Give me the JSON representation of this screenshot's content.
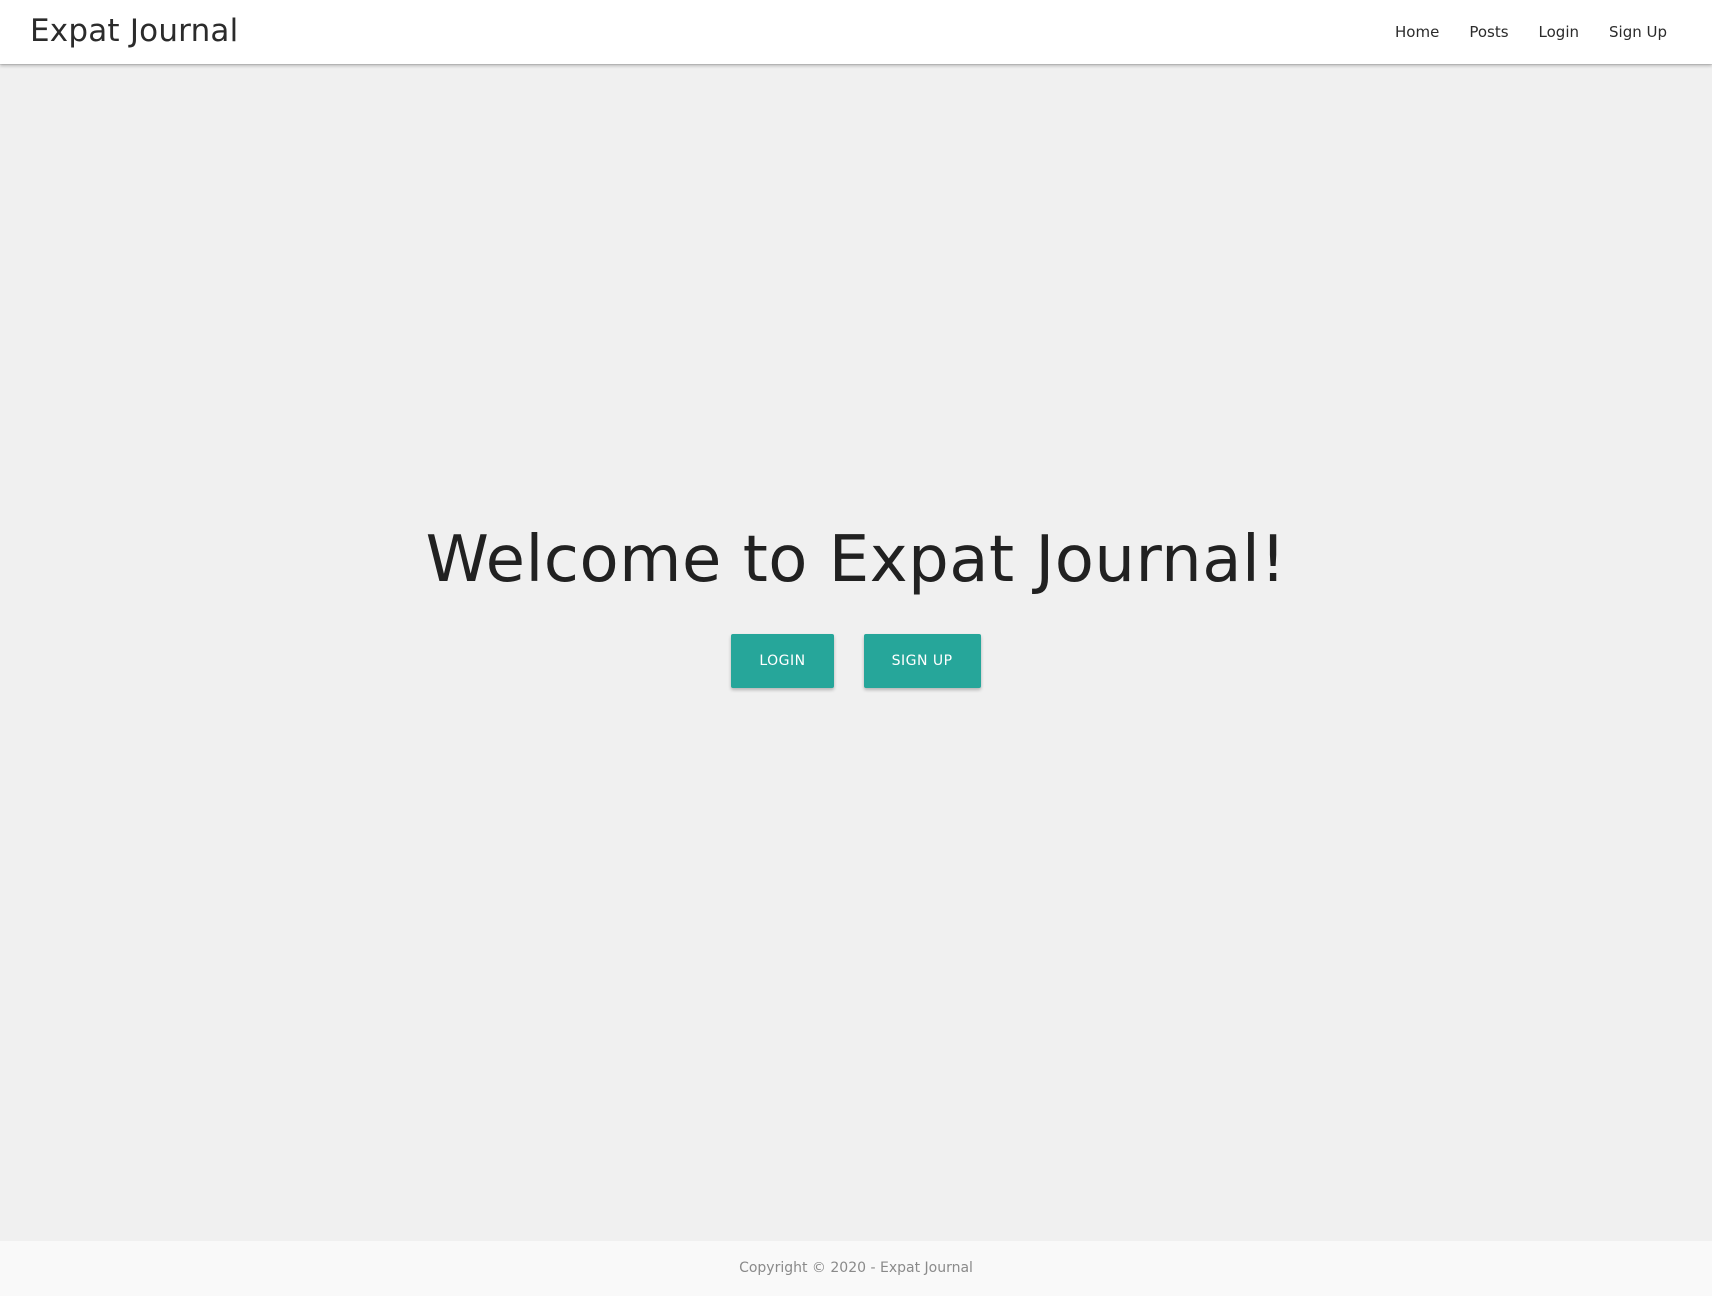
{
  "navbar": {
    "brand": "Expat Journal",
    "links": [
      {
        "label": "Home"
      },
      {
        "label": "Posts"
      },
      {
        "label": "Login"
      },
      {
        "label": "Sign Up"
      }
    ]
  },
  "hero": {
    "title": "Welcome to Expat Journal!",
    "login_label": "LOGIN",
    "signup_label": "SIGN UP"
  },
  "footer": {
    "text": "Copyright © 2020 - Expat Journal"
  },
  "colors": {
    "accent": "#26a69a",
    "background": "#f0f0f0",
    "navbar": "#ffffff",
    "footer": "#f9f9f9"
  }
}
